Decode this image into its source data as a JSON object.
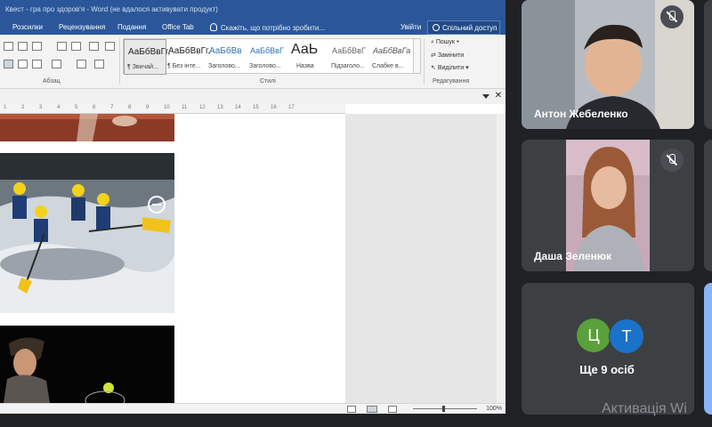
{
  "word": {
    "title": "Квест - гра про здоров'я - Word (не вдалося активувати продукт)",
    "menu": [
      "Розсилки",
      "Рецензування",
      "Подання",
      "Office Tab"
    ],
    "tell_me": "Скажіть, що потрібно зробити...",
    "sign_in": "Увійти",
    "share": "Спільний доступ",
    "groups": {
      "paragraph": "Абзац",
      "styles": "Стилі",
      "editing": "Редагування"
    },
    "styles": [
      {
        "sample": "АаБбВвГг,",
        "name": "¶ Звичай..."
      },
      {
        "sample": "АаБбВвГг,",
        "name": "¶ Без інте..."
      },
      {
        "sample": "АаБбВв",
        "name": "Заголово..."
      },
      {
        "sample": "АаБбВвГ",
        "name": "Заголово..."
      },
      {
        "sample": "АаЬ",
        "name": "Назва"
      },
      {
        "sample": "АаБбВвГ",
        "name": "Підзаголо..."
      },
      {
        "sample": "АаБбВвГа",
        "name": "Слабке в..."
      }
    ],
    "editing": {
      "find": "Пошук",
      "replace": "Замінити",
      "select": "Виділити"
    },
    "ruler_numbers": [
      "1",
      "2",
      "3",
      "4",
      "5",
      "6",
      "7",
      "8",
      "9",
      "10",
      "11",
      "12",
      "13",
      "14",
      "15",
      "16",
      "17"
    ],
    "zoom": "100%"
  },
  "meet": {
    "participants": [
      {
        "name": "Антон Жебеленко"
      },
      {
        "name": "Даша Зеленюк"
      }
    ],
    "more": {
      "avatars": [
        {
          "letter": "Ц",
          "color": "#5aa03b"
        },
        {
          "letter": "Т",
          "color": "#1a73c9"
        }
      ],
      "label": "Ще 9 осіб"
    }
  },
  "os": {
    "activation": "Активація Wi"
  }
}
